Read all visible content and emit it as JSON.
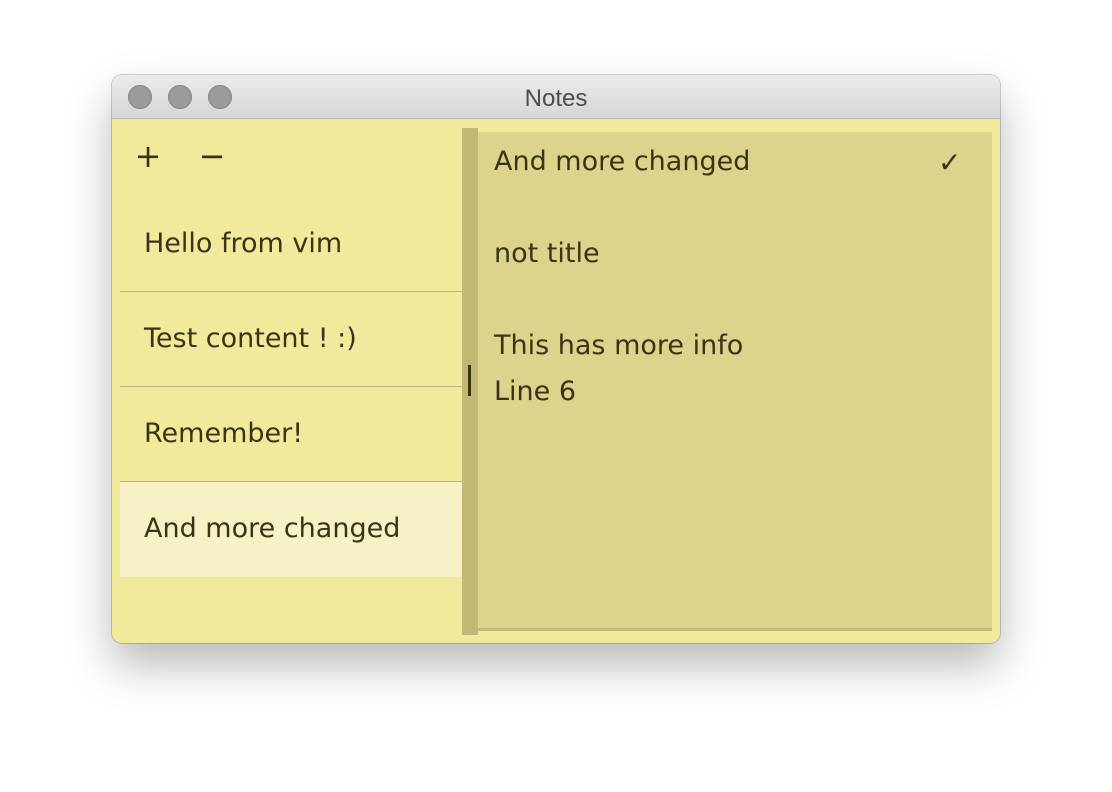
{
  "window": {
    "title": "Notes"
  },
  "toolbar": {
    "add_label": "+",
    "remove_label": "−"
  },
  "notes": [
    {
      "title": "Hello from vim"
    },
    {
      "title": "Test content ! :)"
    },
    {
      "title": "Remember!"
    },
    {
      "title": "And more changed",
      "selected": true
    }
  ],
  "editor": {
    "lines": [
      "And more changed",
      "not title",
      "This has more info",
      "Line 6"
    ],
    "check_icon": "✓"
  },
  "colors": {
    "background": "#f1e99b",
    "editor_background": "#dcd38c",
    "selected_item": "#f7f1c6",
    "text": "#3a3413"
  }
}
